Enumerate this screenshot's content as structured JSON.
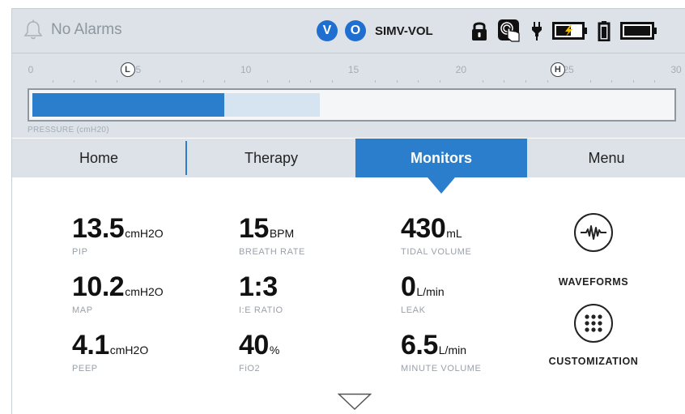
{
  "status_bar": {
    "alarm_text": "No Alarms",
    "badges": [
      "V",
      "O"
    ],
    "mode": "SIMV-VOL",
    "icons": [
      "lock-icon",
      "touch-lock-icon",
      "ac-power-plug-icon",
      "battery-charging-icon",
      "battery-small-icon",
      "battery-full-icon"
    ]
  },
  "pressure_scale": {
    "ticks": [
      "0",
      "5",
      "10",
      "15",
      "20",
      "25",
      "30"
    ],
    "low_marker": "L",
    "high_marker": "H",
    "low_value": 4.5,
    "high_value": 24.5,
    "current_value": 9.0,
    "peak_value": 13.5,
    "max": 30,
    "label": "PRESSURE (cmH20)"
  },
  "tabs": [
    {
      "label": "Home",
      "active": false
    },
    {
      "label": "Therapy",
      "active": false
    },
    {
      "label": "Monitors",
      "active": true
    },
    {
      "label": "Menu",
      "active": false
    }
  ],
  "metrics": {
    "pip": {
      "value": "13.5",
      "unit": "cmH2O",
      "label": "PIP"
    },
    "breath_rate": {
      "value": "15",
      "unit": "BPM",
      "label": "BREATH RATE"
    },
    "tidal_volume": {
      "value": "430",
      "unit": "mL",
      "label": "TIDAL VOLUME"
    },
    "map": {
      "value": "10.2",
      "unit": "cmH2O",
      "label": "MAP"
    },
    "ie_ratio": {
      "value": "1:3",
      "unit": "",
      "label": "I:E RATIO"
    },
    "leak": {
      "value": "0",
      "unit": "L/min",
      "label": "LEAK"
    },
    "peep": {
      "value": "4.1",
      "unit": "cmH2O",
      "label": "PEEP"
    },
    "fio2": {
      "value": "40",
      "unit": "%",
      "label": "FiO2"
    },
    "minute_volume": {
      "value": "6.5",
      "unit": "L/min",
      "label": "MINUTE VOLUME"
    }
  },
  "actions": {
    "waveforms": {
      "label": "WAVEFORMS",
      "icon": "waveform-icon"
    },
    "customization": {
      "label": "CUSTOMIZATION",
      "icon": "dots-grid-icon"
    }
  },
  "colors": {
    "accent": "#2b7ecc",
    "bar_light": "#d6e3f0",
    "panel": "#dde2e8"
  }
}
